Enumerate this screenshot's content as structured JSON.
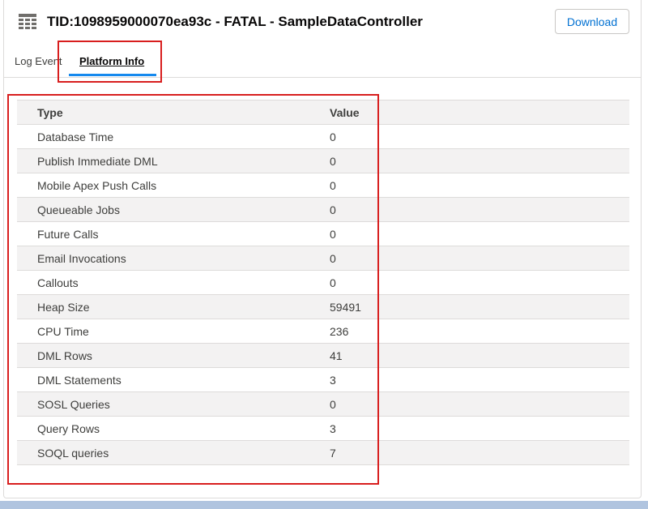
{
  "header": {
    "title": "TID:1098959000070ea93c - FATAL - SampleDataController",
    "icon": "table-list-icon",
    "download_label": "Download"
  },
  "tabs": [
    {
      "label": "Log Event",
      "active": false
    },
    {
      "label": "Platform Info",
      "active": true
    }
  ],
  "table": {
    "columns": [
      "Type",
      "Value"
    ],
    "rows": [
      {
        "type": "Database Time",
        "value": "0"
      },
      {
        "type": "Publish Immediate DML",
        "value": "0"
      },
      {
        "type": "Mobile Apex Push Calls",
        "value": "0"
      },
      {
        "type": "Queueable Jobs",
        "value": "0"
      },
      {
        "type": "Future Calls",
        "value": "0"
      },
      {
        "type": "Email Invocations",
        "value": "0"
      },
      {
        "type": "Callouts",
        "value": "0"
      },
      {
        "type": "Heap Size",
        "value": "59491"
      },
      {
        "type": "CPU Time",
        "value": "236"
      },
      {
        "type": "DML Rows",
        "value": "41"
      },
      {
        "type": "DML Statements",
        "value": "3"
      },
      {
        "type": "SOSL Queries",
        "value": "0"
      },
      {
        "type": "Query Rows",
        "value": "3"
      },
      {
        "type": "SOQL queries",
        "value": "7"
      }
    ]
  },
  "colors": {
    "accent": "#1589ee",
    "link": "#0070d2",
    "highlight": "#d81e1e"
  }
}
